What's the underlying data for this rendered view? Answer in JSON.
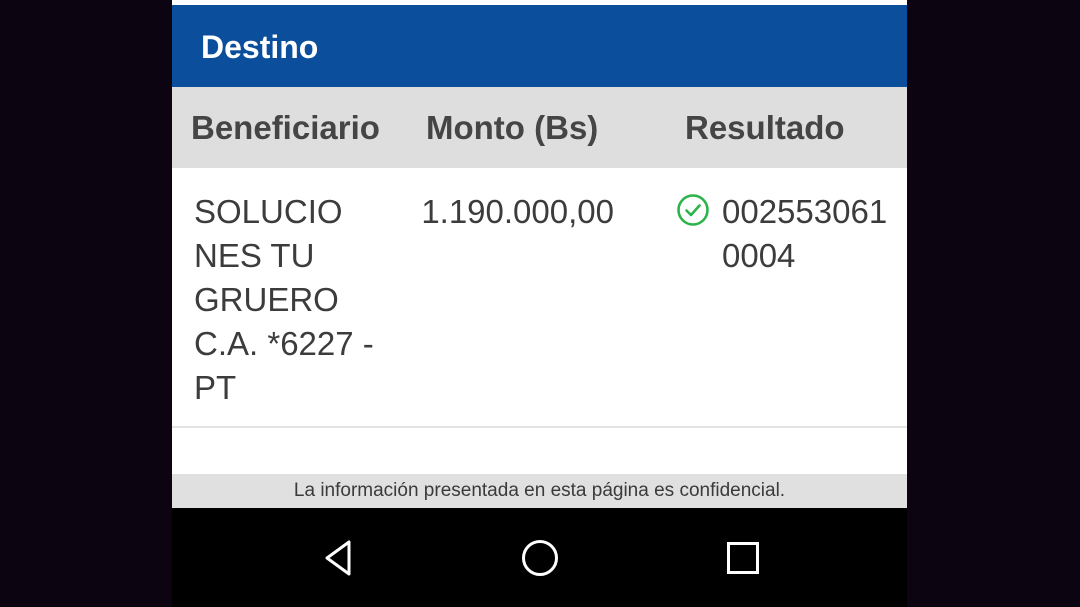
{
  "header": {
    "title": "Destino"
  },
  "table": {
    "columns": [
      "Beneficiario",
      "Monto (Bs)",
      "Resultado"
    ],
    "rows": [
      {
        "beneficiario": "SOLUCIO\nNES TU\nGRUERO\nC.A.  *6227 -\nPT",
        "monto": "1.190.000,00",
        "resultado": "0025530610004",
        "status_icon": "check-circle-icon",
        "status_color": "#2cb34a"
      }
    ]
  },
  "footer": {
    "text": "La información presentada en esta página es confidencial."
  },
  "navbar": {
    "buttons": [
      "back-icon",
      "home-icon",
      "recent-apps-icon"
    ]
  },
  "colors": {
    "header_bg": "#0b4f9c",
    "column_header_bg": "#dedede",
    "success": "#2cb34a"
  }
}
